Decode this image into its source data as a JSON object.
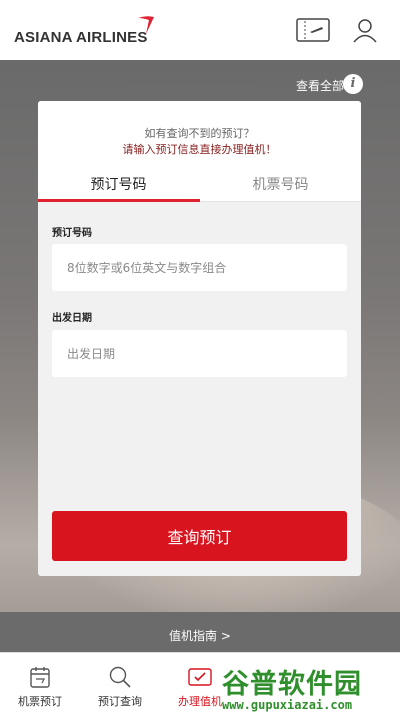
{
  "header": {
    "logo_text": "ASIANA AIRLINES",
    "logo_color": "#333333",
    "accent_color": "#e0212f",
    "icons": [
      "boarding-pass-icon",
      "user-icon"
    ]
  },
  "top_link": {
    "view_all": "查看全部",
    "chevron": ">",
    "info": "i"
  },
  "card": {
    "hint_line1": "如有查询不到的预订？",
    "hint_line2": "请输入预订信息直接办理值机！",
    "tabs": [
      {
        "label": "预订号码",
        "active": true
      },
      {
        "label": "机票号码",
        "active": false
      }
    ],
    "booking_label": "预订号码",
    "booking_placeholder": "8位数字或6位英文与数字组合",
    "date_label": "出发日期",
    "date_placeholder": "出发日期",
    "submit_label": "查询预订",
    "submit_color": "#d8141f"
  },
  "guide": {
    "label": "值机指南",
    "chevron": ">"
  },
  "tabbar": {
    "items": [
      {
        "label": "机票预订",
        "icon": "calendar-icon",
        "active": false
      },
      {
        "label": "预订查询",
        "icon": "search-icon",
        "active": false
      },
      {
        "label": "办理值机",
        "icon": "checkin-icon",
        "active": true
      }
    ]
  },
  "watermark": {
    "title": "谷普软件园",
    "url": "www.gupuxiazai.com",
    "color": "#2f8f2c"
  }
}
